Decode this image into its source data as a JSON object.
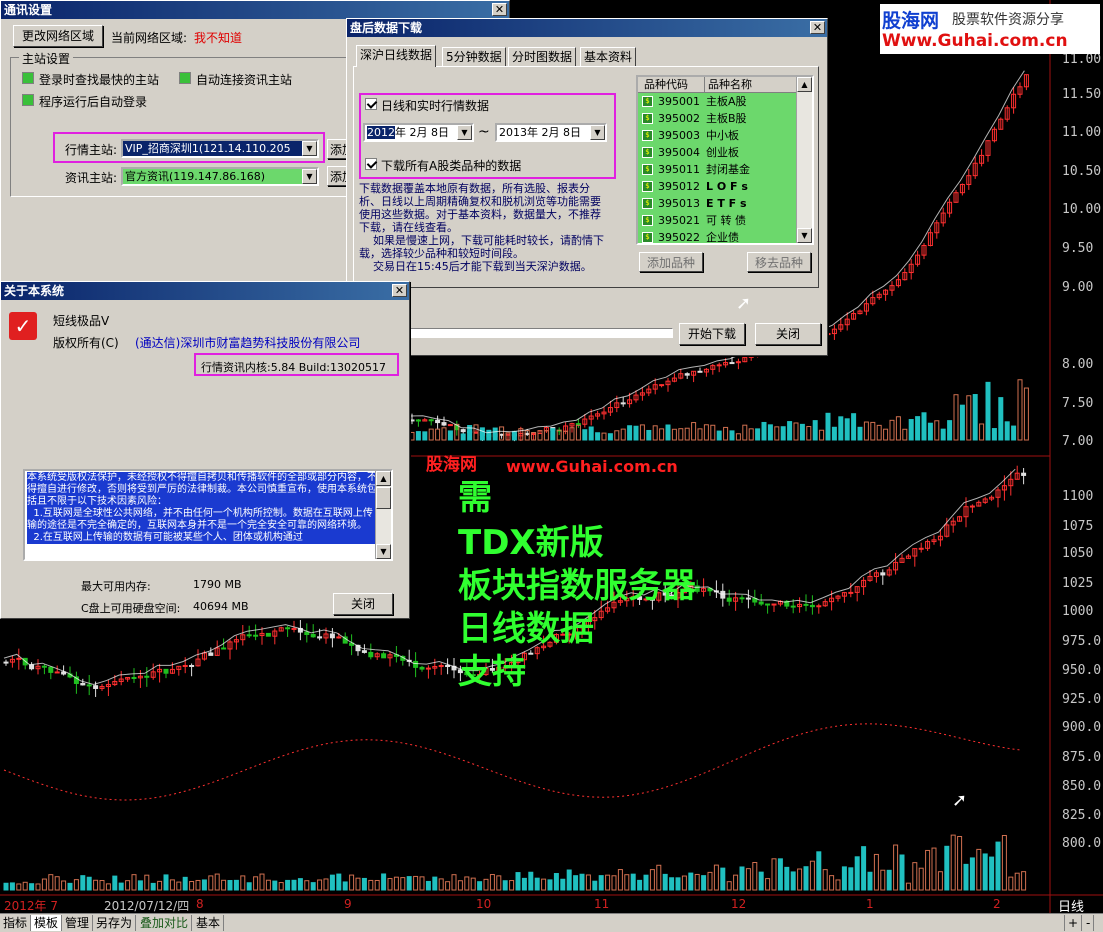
{
  "chart": {
    "price_labels": [
      "11.00",
      "11.50",
      "11.00",
      "10.50",
      "10.00",
      "9.50",
      "9.00",
      "8.00",
      "7.50",
      "7.00",
      "1100",
      "1075",
      "1050",
      "1025",
      "1000",
      "975.0",
      "950.0",
      "925.0",
      "900.0",
      "875.0",
      "850.0",
      "825.0",
      "800.0"
    ],
    "xaxis_labels": [
      "2012年 7",
      "2012/07/12/四",
      "8",
      "9",
      "10",
      "11",
      "12",
      "1",
      "2"
    ],
    "period_label": "日线",
    "watermark_logo": "股海网",
    "watermark_url": "www.Guhai.com.cn",
    "brand_logo": "股海网",
    "brand_tagline": "股票软件资源分享",
    "brand_url": "Www.Guhai.com.cn",
    "overlay_lines": [
      "需",
      "TDX新版",
      "板块指数服务器",
      "日线数据",
      "支持"
    ]
  },
  "bottom_tabs": [
    "指标",
    "模板",
    "管理",
    "另存为",
    "叠加对比",
    "基本"
  ],
  "bottom_right": {
    "label": "日线",
    "plus": "+",
    "minus": "-"
  },
  "comm_dialog": {
    "title": "通讯设置",
    "change_region_button": "更改网络区域",
    "current_region_label": "当前网络区域:",
    "current_region_value": "我不知道",
    "main_station_group": "主站设置",
    "opt_fastest": "登录时查找最快的主站",
    "opt_auto_connect": "自动连接资讯主站",
    "opt_auto_login": "程序运行后自动登录",
    "quote_label": "行情主站:",
    "quote_value": "VIP_招商深圳1(121.14.110.205",
    "info_label": "资讯主站:",
    "info_value": "官方资讯(119.147.86.168)",
    "add_btn1": "添加",
    "add_btn2": "添加"
  },
  "download_dialog": {
    "title": "盘后数据下载",
    "tabs": [
      "深沪日线数据",
      "5分钟数据",
      "分时图数据",
      "基本资料"
    ],
    "daily_check_label": "日线和实时行情数据",
    "start_year": "2012",
    "start_rest": "年 2月 8日",
    "tilde": "~",
    "end_date": "2013年 2月 8日",
    "all_a_check_label": "下载所有A股类品种的数据",
    "desc": "下载数据覆盖本地原有数据，所有选股、报表分析、日线以上周期精确复权和脱机浏览等功能需要使用这些数据。对于基本资料，数据量大，不推荐下载，请在线查看。\n    如果是慢速上网，下载可能耗时较长，请酌情下载，选择较少品种和较短时间段。\n    交易日在15:45后才能下载到当天深沪数据。",
    "list_headers": [
      "品种代码",
      "品种名称"
    ],
    "list": [
      {
        "code": "395001",
        "name": "主板A股"
      },
      {
        "code": "395002",
        "name": "主板B股"
      },
      {
        "code": "395003",
        "name": "中小板"
      },
      {
        "code": "395004",
        "name": "创业板"
      },
      {
        "code": "395011",
        "name": "封闭基金"
      },
      {
        "code": "395012",
        "name": "L O F s"
      },
      {
        "code": "395013",
        "name": "E T F s"
      },
      {
        "code": "395021",
        "name": "可 转 债"
      },
      {
        "code": "395022",
        "name": "企业债"
      }
    ],
    "add_item": "添加品种",
    "remove_item": "移去品种",
    "start_download": "开始下载",
    "close": "关闭"
  },
  "about_dialog": {
    "title": "关于本系统",
    "product": "短线极品V",
    "copyright_label": "版权所有(C)",
    "company": "(通达信)深圳市财富趋势科技股份有限公司",
    "version": "行情资讯内核:5.84 Build:13020517",
    "license_text": "本系统受版权法保护，未经授权不得擅自拷贝和传播软件的全部或部分内容，不得擅自进行修改，否则将受到严厉的法律制裁。本公司慎重宣布，使用本系统包括且不限于以下技术因素风险：\n  1.互联网是全球性公共网络，并不由任何一个机构所控制。数据在互联网上传输的途径是不完全确定的，互联网本身并不是一个完全安全可靠的网络环境。\n  2.在互联网上传输的数据有可能被某些个人、团体或机构通过",
    "mem_label": "最大可用内存:",
    "mem_value": "1790 MB",
    "disk_label": "C盘上可用硬盘空间:",
    "disk_value": "40694 MB",
    "close": "关闭"
  }
}
